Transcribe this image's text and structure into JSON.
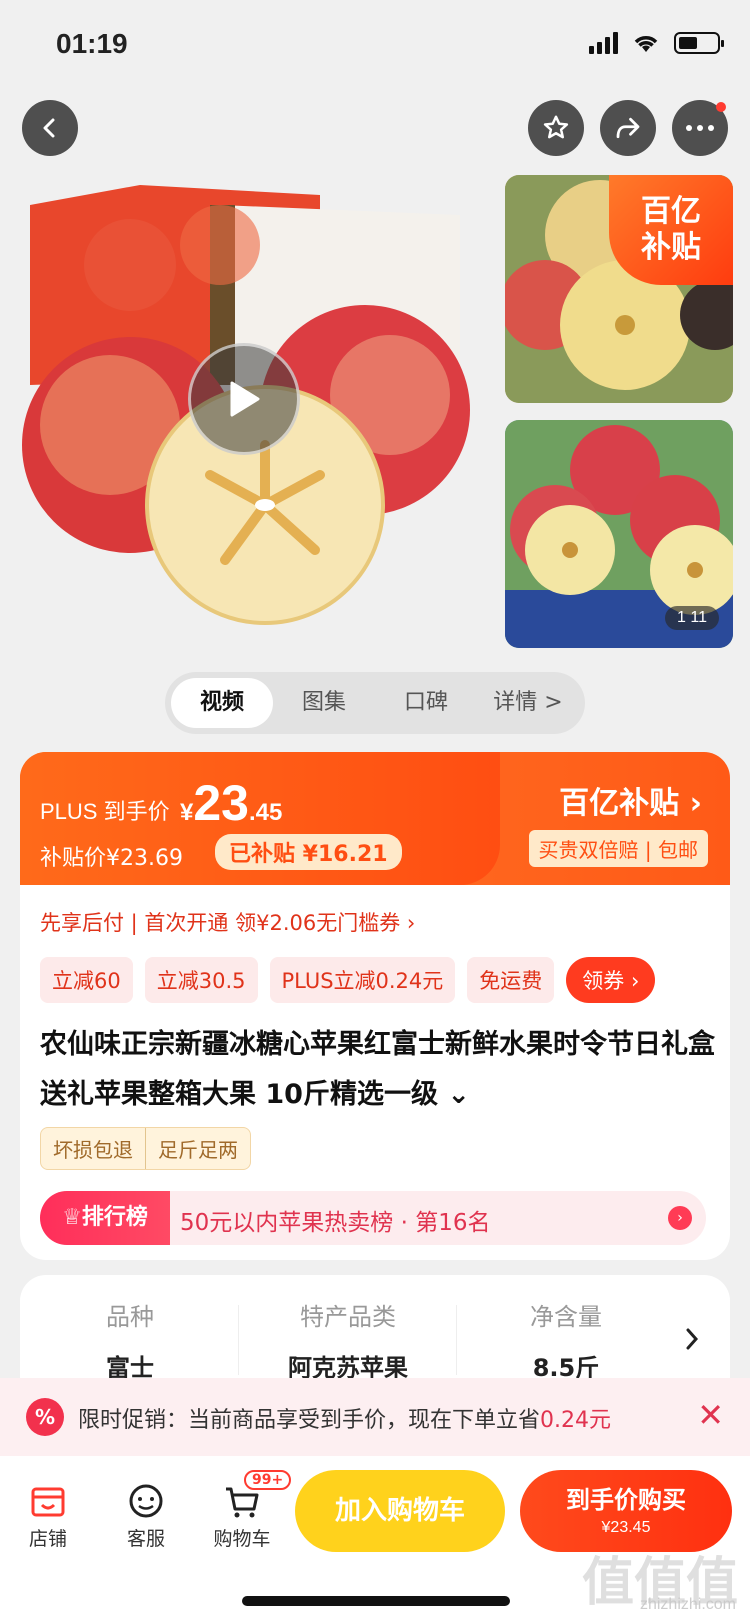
{
  "status": {
    "time": "01:19"
  },
  "gallery": {
    "subsidy_tag_l1": "百亿",
    "subsidy_tag_l2": "补贴",
    "counter": "1 11"
  },
  "media_tabs": [
    "视频",
    "图集",
    "口碑",
    "详情 >"
  ],
  "price": {
    "plus_label": "PLUS 到手价",
    "currency": "¥",
    "int": "23",
    "dec": ".45",
    "subsidy_label": "补贴价¥23.69",
    "subsidy_badge": "已补贴 ¥16.21",
    "logo": "百亿补贴",
    "note": "买贵双倍赔 | 包邮"
  },
  "pay_row": "先享后付 | 首次开通 领¥2.06无门槛券 ›",
  "chips": [
    "立减60",
    "立减30.5",
    "PLUS立减0.24元",
    "免运费"
  ],
  "coupon": "领券",
  "title": "农仙味正宗新疆冰糖心苹果红富士新鲜水果时令节日礼盒送礼苹果整箱大果 10斤精选一级",
  "guarantees": [
    "坏损包退",
    "足斤足两"
  ],
  "rank": {
    "badge": "排行榜",
    "text": "50元以内苹果热卖榜 · 第16名"
  },
  "specs": [
    {
      "k": "品种",
      "v": "富士"
    },
    {
      "k": "特产品类",
      "v": "阿克苏苹果"
    },
    {
      "k": "净含量",
      "v": "8.5斤"
    }
  ],
  "promo": {
    "icon": "%",
    "text": "限时促销：当前商品享受到手价，现在下单立省",
    "amount": "0.24元"
  },
  "bottom": {
    "store": "店铺",
    "service": "客服",
    "cart": "购物车",
    "cart_badge": "99+",
    "add_cart": "加入购物车",
    "buy": "到手价购买",
    "buy_price": "¥23.45"
  },
  "watermark": {
    "main": "值值值",
    "sub": "zhizhizhi.com"
  }
}
